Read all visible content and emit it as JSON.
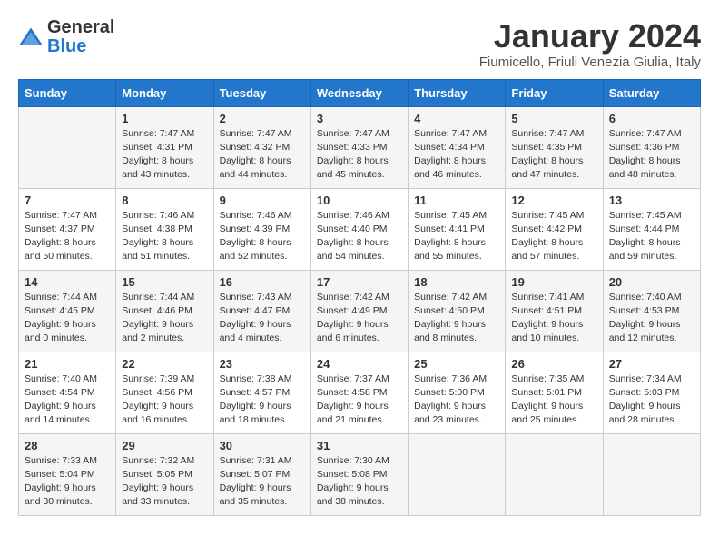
{
  "logo": {
    "general": "General",
    "blue": "Blue"
  },
  "title": "January 2024",
  "location": "Fiumicello, Friuli Venezia Giulia, Italy",
  "days_of_week": [
    "Sunday",
    "Monday",
    "Tuesday",
    "Wednesday",
    "Thursday",
    "Friday",
    "Saturday"
  ],
  "weeks": [
    [
      {
        "day": "",
        "sunrise": "",
        "sunset": "",
        "daylight": ""
      },
      {
        "day": "1",
        "sunrise": "Sunrise: 7:47 AM",
        "sunset": "Sunset: 4:31 PM",
        "daylight": "Daylight: 8 hours and 43 minutes."
      },
      {
        "day": "2",
        "sunrise": "Sunrise: 7:47 AM",
        "sunset": "Sunset: 4:32 PM",
        "daylight": "Daylight: 8 hours and 44 minutes."
      },
      {
        "day": "3",
        "sunrise": "Sunrise: 7:47 AM",
        "sunset": "Sunset: 4:33 PM",
        "daylight": "Daylight: 8 hours and 45 minutes."
      },
      {
        "day": "4",
        "sunrise": "Sunrise: 7:47 AM",
        "sunset": "Sunset: 4:34 PM",
        "daylight": "Daylight: 8 hours and 46 minutes."
      },
      {
        "day": "5",
        "sunrise": "Sunrise: 7:47 AM",
        "sunset": "Sunset: 4:35 PM",
        "daylight": "Daylight: 8 hours and 47 minutes."
      },
      {
        "day": "6",
        "sunrise": "Sunrise: 7:47 AM",
        "sunset": "Sunset: 4:36 PM",
        "daylight": "Daylight: 8 hours and 48 minutes."
      }
    ],
    [
      {
        "day": "7",
        "sunrise": "Sunrise: 7:47 AM",
        "sunset": "Sunset: 4:37 PM",
        "daylight": "Daylight: 8 hours and 50 minutes."
      },
      {
        "day": "8",
        "sunrise": "Sunrise: 7:46 AM",
        "sunset": "Sunset: 4:38 PM",
        "daylight": "Daylight: 8 hours and 51 minutes."
      },
      {
        "day": "9",
        "sunrise": "Sunrise: 7:46 AM",
        "sunset": "Sunset: 4:39 PM",
        "daylight": "Daylight: 8 hours and 52 minutes."
      },
      {
        "day": "10",
        "sunrise": "Sunrise: 7:46 AM",
        "sunset": "Sunset: 4:40 PM",
        "daylight": "Daylight: 8 hours and 54 minutes."
      },
      {
        "day": "11",
        "sunrise": "Sunrise: 7:45 AM",
        "sunset": "Sunset: 4:41 PM",
        "daylight": "Daylight: 8 hours and 55 minutes."
      },
      {
        "day": "12",
        "sunrise": "Sunrise: 7:45 AM",
        "sunset": "Sunset: 4:42 PM",
        "daylight": "Daylight: 8 hours and 57 minutes."
      },
      {
        "day": "13",
        "sunrise": "Sunrise: 7:45 AM",
        "sunset": "Sunset: 4:44 PM",
        "daylight": "Daylight: 8 hours and 59 minutes."
      }
    ],
    [
      {
        "day": "14",
        "sunrise": "Sunrise: 7:44 AM",
        "sunset": "Sunset: 4:45 PM",
        "daylight": "Daylight: 9 hours and 0 minutes."
      },
      {
        "day": "15",
        "sunrise": "Sunrise: 7:44 AM",
        "sunset": "Sunset: 4:46 PM",
        "daylight": "Daylight: 9 hours and 2 minutes."
      },
      {
        "day": "16",
        "sunrise": "Sunrise: 7:43 AM",
        "sunset": "Sunset: 4:47 PM",
        "daylight": "Daylight: 9 hours and 4 minutes."
      },
      {
        "day": "17",
        "sunrise": "Sunrise: 7:42 AM",
        "sunset": "Sunset: 4:49 PM",
        "daylight": "Daylight: 9 hours and 6 minutes."
      },
      {
        "day": "18",
        "sunrise": "Sunrise: 7:42 AM",
        "sunset": "Sunset: 4:50 PM",
        "daylight": "Daylight: 9 hours and 8 minutes."
      },
      {
        "day": "19",
        "sunrise": "Sunrise: 7:41 AM",
        "sunset": "Sunset: 4:51 PM",
        "daylight": "Daylight: 9 hours and 10 minutes."
      },
      {
        "day": "20",
        "sunrise": "Sunrise: 7:40 AM",
        "sunset": "Sunset: 4:53 PM",
        "daylight": "Daylight: 9 hours and 12 minutes."
      }
    ],
    [
      {
        "day": "21",
        "sunrise": "Sunrise: 7:40 AM",
        "sunset": "Sunset: 4:54 PM",
        "daylight": "Daylight: 9 hours and 14 minutes."
      },
      {
        "day": "22",
        "sunrise": "Sunrise: 7:39 AM",
        "sunset": "Sunset: 4:56 PM",
        "daylight": "Daylight: 9 hours and 16 minutes."
      },
      {
        "day": "23",
        "sunrise": "Sunrise: 7:38 AM",
        "sunset": "Sunset: 4:57 PM",
        "daylight": "Daylight: 9 hours and 18 minutes."
      },
      {
        "day": "24",
        "sunrise": "Sunrise: 7:37 AM",
        "sunset": "Sunset: 4:58 PM",
        "daylight": "Daylight: 9 hours and 21 minutes."
      },
      {
        "day": "25",
        "sunrise": "Sunrise: 7:36 AM",
        "sunset": "Sunset: 5:00 PM",
        "daylight": "Daylight: 9 hours and 23 minutes."
      },
      {
        "day": "26",
        "sunrise": "Sunrise: 7:35 AM",
        "sunset": "Sunset: 5:01 PM",
        "daylight": "Daylight: 9 hours and 25 minutes."
      },
      {
        "day": "27",
        "sunrise": "Sunrise: 7:34 AM",
        "sunset": "Sunset: 5:03 PM",
        "daylight": "Daylight: 9 hours and 28 minutes."
      }
    ],
    [
      {
        "day": "28",
        "sunrise": "Sunrise: 7:33 AM",
        "sunset": "Sunset: 5:04 PM",
        "daylight": "Daylight: 9 hours and 30 minutes."
      },
      {
        "day": "29",
        "sunrise": "Sunrise: 7:32 AM",
        "sunset": "Sunset: 5:05 PM",
        "daylight": "Daylight: 9 hours and 33 minutes."
      },
      {
        "day": "30",
        "sunrise": "Sunrise: 7:31 AM",
        "sunset": "Sunset: 5:07 PM",
        "daylight": "Daylight: 9 hours and 35 minutes."
      },
      {
        "day": "31",
        "sunrise": "Sunrise: 7:30 AM",
        "sunset": "Sunset: 5:08 PM",
        "daylight": "Daylight: 9 hours and 38 minutes."
      },
      {
        "day": "",
        "sunrise": "",
        "sunset": "",
        "daylight": ""
      },
      {
        "day": "",
        "sunrise": "",
        "sunset": "",
        "daylight": ""
      },
      {
        "day": "",
        "sunrise": "",
        "sunset": "",
        "daylight": ""
      }
    ]
  ]
}
